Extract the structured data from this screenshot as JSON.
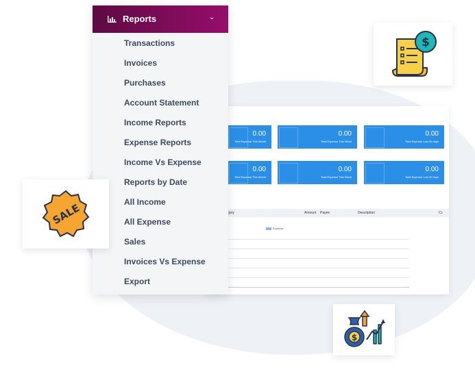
{
  "menu": {
    "title": "Reports",
    "items": [
      "Transactions",
      "Invoices",
      "Purchases",
      "Account Statement",
      "Income Reports",
      "Expense Reports",
      "Income Vs Expense",
      "Reports by Date",
      "All Income",
      "All Expense",
      "Sales",
      "Invoices Vs Expense",
      "Export"
    ]
  },
  "stats": [
    {
      "value": "0.00",
      "label": "Total Expense This Month"
    },
    {
      "value": "0.00",
      "label": "Total Expense This Week"
    },
    {
      "value": "0.00",
      "label": "Total Expense Last 30 days"
    },
    {
      "value": "0.00",
      "label": "Total Expense This Month"
    },
    {
      "value": "0.00",
      "label": "Total Expense This Week"
    },
    {
      "value": "0.00",
      "label": "Total Expense Last 30 days"
    }
  ],
  "table": {
    "category": "gory",
    "amount": "Amount",
    "payee": "Payee",
    "description": "Description",
    "cr": "Cr."
  },
  "chart": {
    "legend": "Expense"
  },
  "sale_badge": "SALE",
  "colors": {
    "accent_purple": "#8b0d63",
    "tile_blue": "#2b8fe8",
    "badge_orange": "#f7a531"
  }
}
